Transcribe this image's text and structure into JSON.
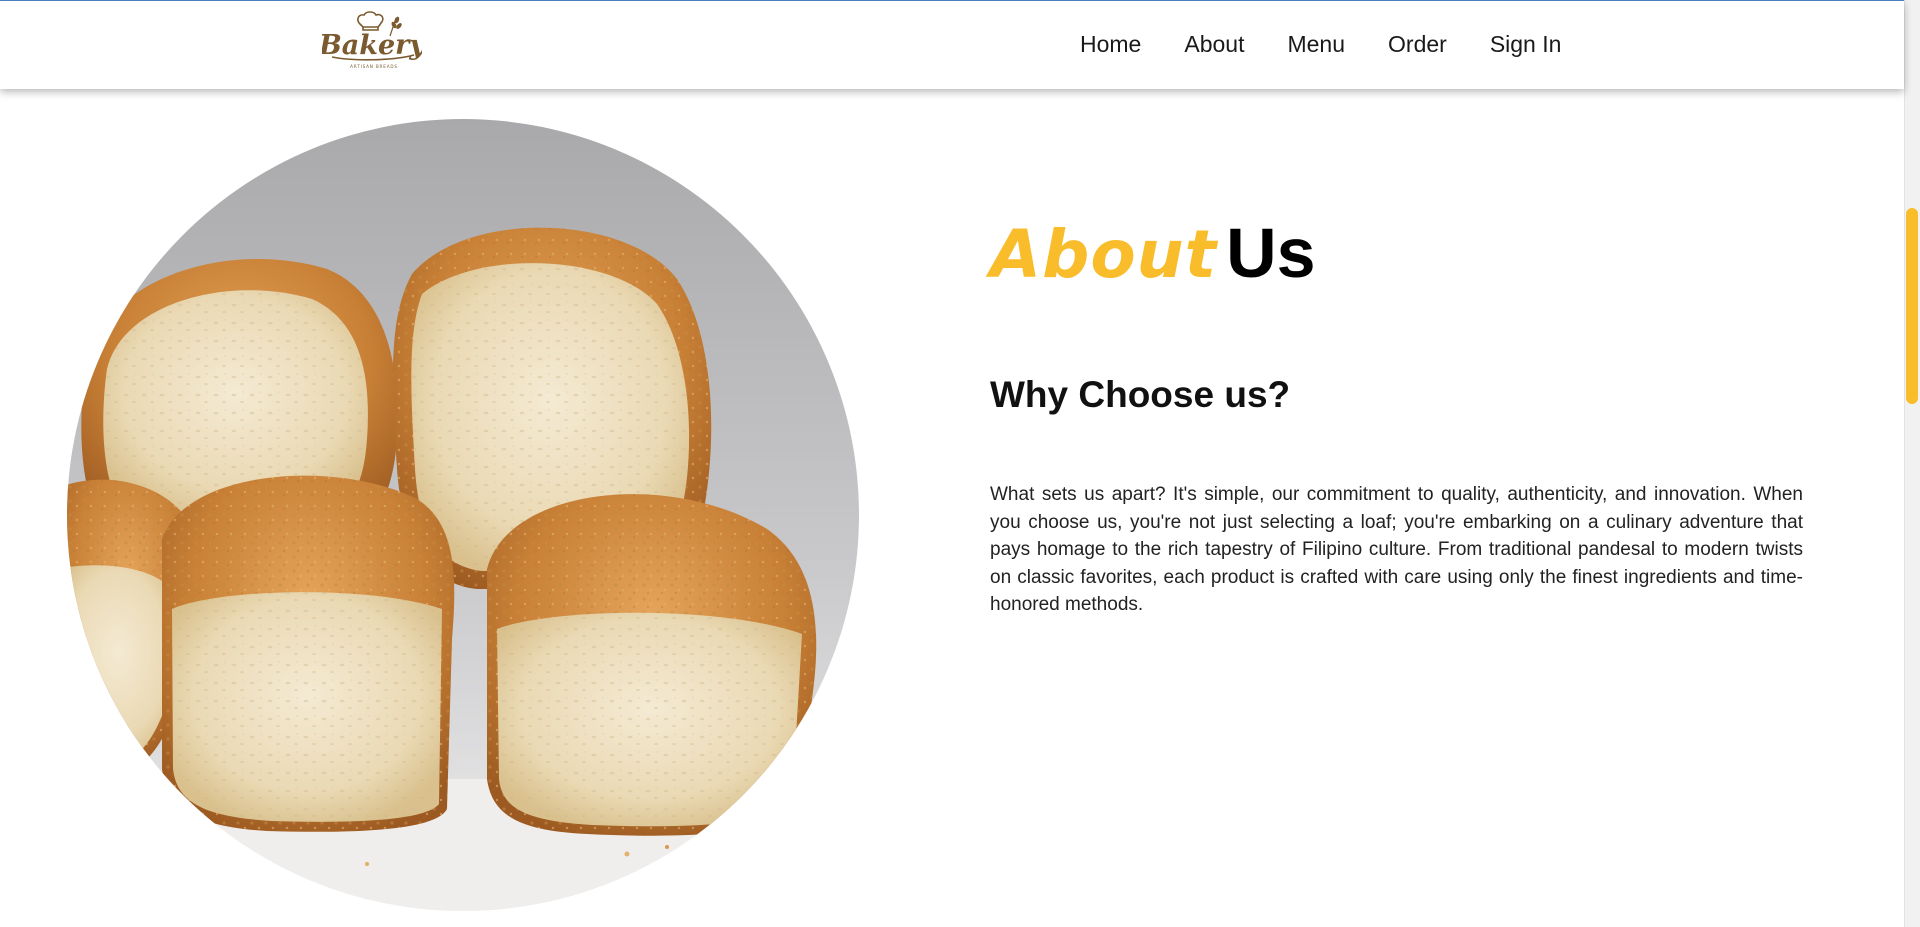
{
  "brand": {
    "logo_text": "Bakery",
    "logo_tagline": "ARTISAN BREADS",
    "logo_color": "#7a5a2e"
  },
  "nav": {
    "items": [
      {
        "label": "Home"
      },
      {
        "label": "About"
      },
      {
        "label": "Menu"
      },
      {
        "label": "Order"
      },
      {
        "label": "Sign In"
      }
    ]
  },
  "about": {
    "title_accent": "About",
    "title_rest": "Us",
    "accent_color": "#f9bd2b",
    "subtitle": "Why Choose us?",
    "paragraph": "What sets us apart? It's simple, our commitment to quality, authenticity, and innovation. When you choose us, you're not just selecting a loaf; you're embarking on a culinary adventure that pays homage to the rich tapestry of Filipino culture. From traditional pandesal to modern twists on classic favorites, each product is crafted with care using only the finest ingredients and time-honored methods."
  },
  "image": {
    "subject": "pandesal bread rolls"
  },
  "scrollbar": {
    "thumb_color": "#f9bd2b"
  }
}
